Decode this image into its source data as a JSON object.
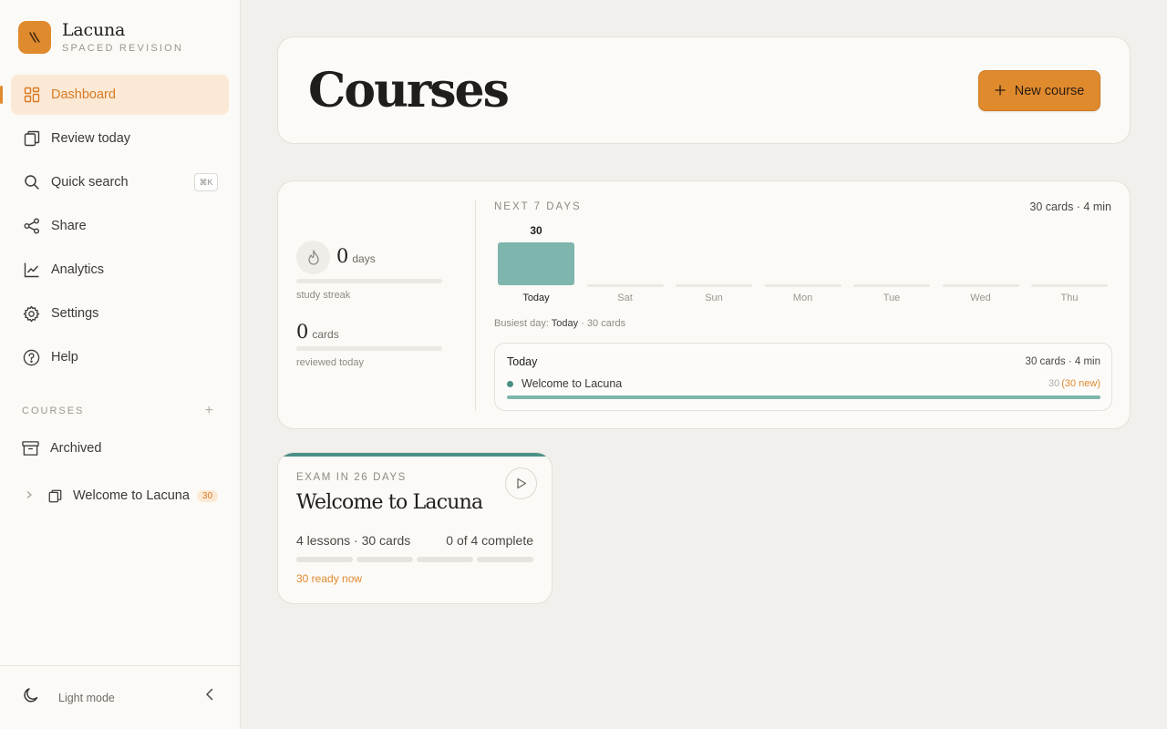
{
  "brand": {
    "name": "Lacuna",
    "subtitle": "SPACED REVISION"
  },
  "nav": [
    {
      "label": "Dashboard",
      "icon": "dashboard-icon",
      "active": true
    },
    {
      "label": "Review today",
      "icon": "cards-icon"
    },
    {
      "label": "Quick search",
      "icon": "search-icon",
      "shortcut": "⌘K"
    },
    {
      "label": "Share",
      "icon": "share-icon"
    },
    {
      "label": "Analytics",
      "icon": "analytics-icon"
    },
    {
      "label": "Settings",
      "icon": "gear-icon"
    },
    {
      "label": "Help",
      "icon": "help-icon"
    }
  ],
  "courses_section": {
    "heading": "COURSES",
    "add": "+",
    "archived_label": "Archived",
    "items": [
      {
        "label": "Welcome to Lacuna",
        "count": "30"
      }
    ]
  },
  "footer": {
    "mode_label": "Light mode"
  },
  "header": {
    "title": "Courses",
    "new_course_label": "New course"
  },
  "stats": {
    "streak_value": "0",
    "streak_unit": "days",
    "streak_label": "study streak",
    "reviewed_value": "0",
    "reviewed_unit": "cards",
    "reviewed_label": "reviewed today"
  },
  "forecast": {
    "heading": "NEXT 7 DAYS",
    "summary": "30 cards · 4 min",
    "busiest_prefix": "Busiest day:",
    "busiest_day": "Today",
    "busiest_suffix": "· 30 cards",
    "chart_data": {
      "type": "bar",
      "categories": [
        "Today",
        "Sat",
        "Sun",
        "Mon",
        "Tue",
        "Wed",
        "Thu"
      ],
      "values": [
        30,
        0,
        0,
        0,
        0,
        0,
        0
      ],
      "value_labels": [
        "30",
        "",
        "",
        "",
        "",
        "",
        ""
      ]
    }
  },
  "today": {
    "title": "Today",
    "summary": "30 cards · 4 min",
    "course_name": "Welcome to Lacuna",
    "count": "30",
    "new_count": "(30 new)",
    "progress": 1.0
  },
  "course_card": {
    "exam_label": "EXAM IN 26 DAYS",
    "title": "Welcome to Lacuna",
    "meta": "4 lessons · 30 cards",
    "complete": "0 of 4 complete",
    "ready": "30 ready now",
    "lessons_total": 4,
    "lessons_done": 0
  },
  "colors": {
    "accent": "#e08a2e",
    "teal": "#7eb5ad",
    "teal_dark": "#4a8f86"
  }
}
